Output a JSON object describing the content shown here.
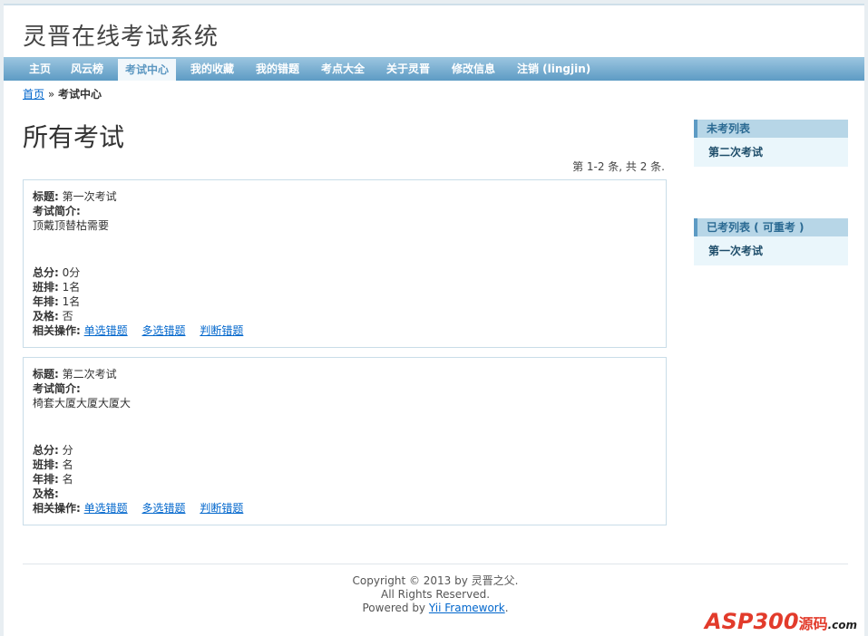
{
  "site_title": "灵晋在线考试系统",
  "nav": [
    {
      "label": "主页"
    },
    {
      "label": "风云榜"
    },
    {
      "label": "考试中心"
    },
    {
      "label": "我的收藏"
    },
    {
      "label": "我的错题"
    },
    {
      "label": "考点大全"
    },
    {
      "label": "关于灵晋"
    },
    {
      "label": "修改信息"
    },
    {
      "label": "注销 (lingjin)"
    }
  ],
  "breadcrumb": {
    "home": "首页",
    "sep": "»",
    "current": "考试中心"
  },
  "heading": "所有考试",
  "summary": "第 1-2 条, 共 2 条.",
  "exams": [
    {
      "title_label": "标题:",
      "title": "第一次考试",
      "intro_label": "考试简介:",
      "intro": "顶戴顶替枯需要",
      "score_label": "总分:",
      "score": "0分",
      "class_rank_label": "班排:",
      "class_rank": "1名",
      "grade_rank_label": "年排:",
      "grade_rank": "1名",
      "pass_label": "及格:",
      "pass": "否",
      "actions_label": "相关操作:",
      "actions": [
        "单选错题",
        "多选错题",
        "判断错题"
      ]
    },
    {
      "title_label": "标题:",
      "title": "第二次考试",
      "intro_label": "考试简介:",
      "intro": "椅套大厦大厦大厦大",
      "score_label": "总分:",
      "score": "分",
      "class_rank_label": "班排:",
      "class_rank": "名",
      "grade_rank_label": "年排:",
      "grade_rank": "名",
      "pass_label": "及格:",
      "pass": "",
      "actions_label": "相关操作:",
      "actions": [
        "单选错题",
        "多选错题",
        "判断错题"
      ]
    }
  ],
  "sidebar": {
    "pending_title": "未考列表",
    "pending_items": [
      "第二次考试"
    ],
    "done_title": "已考列表 ( 可重考 )",
    "done_items": [
      "第一次考试"
    ]
  },
  "footer": {
    "copyright": "Copyright © 2013 by 灵晋之父.",
    "rights": "All Rights Reserved.",
    "powered_prefix": "Powered by",
    "powered_link": "Yii Framework",
    "powered_suffix": "."
  },
  "watermark": {
    "text": "ASP300",
    "cn": "源码",
    "domain": ".com"
  }
}
